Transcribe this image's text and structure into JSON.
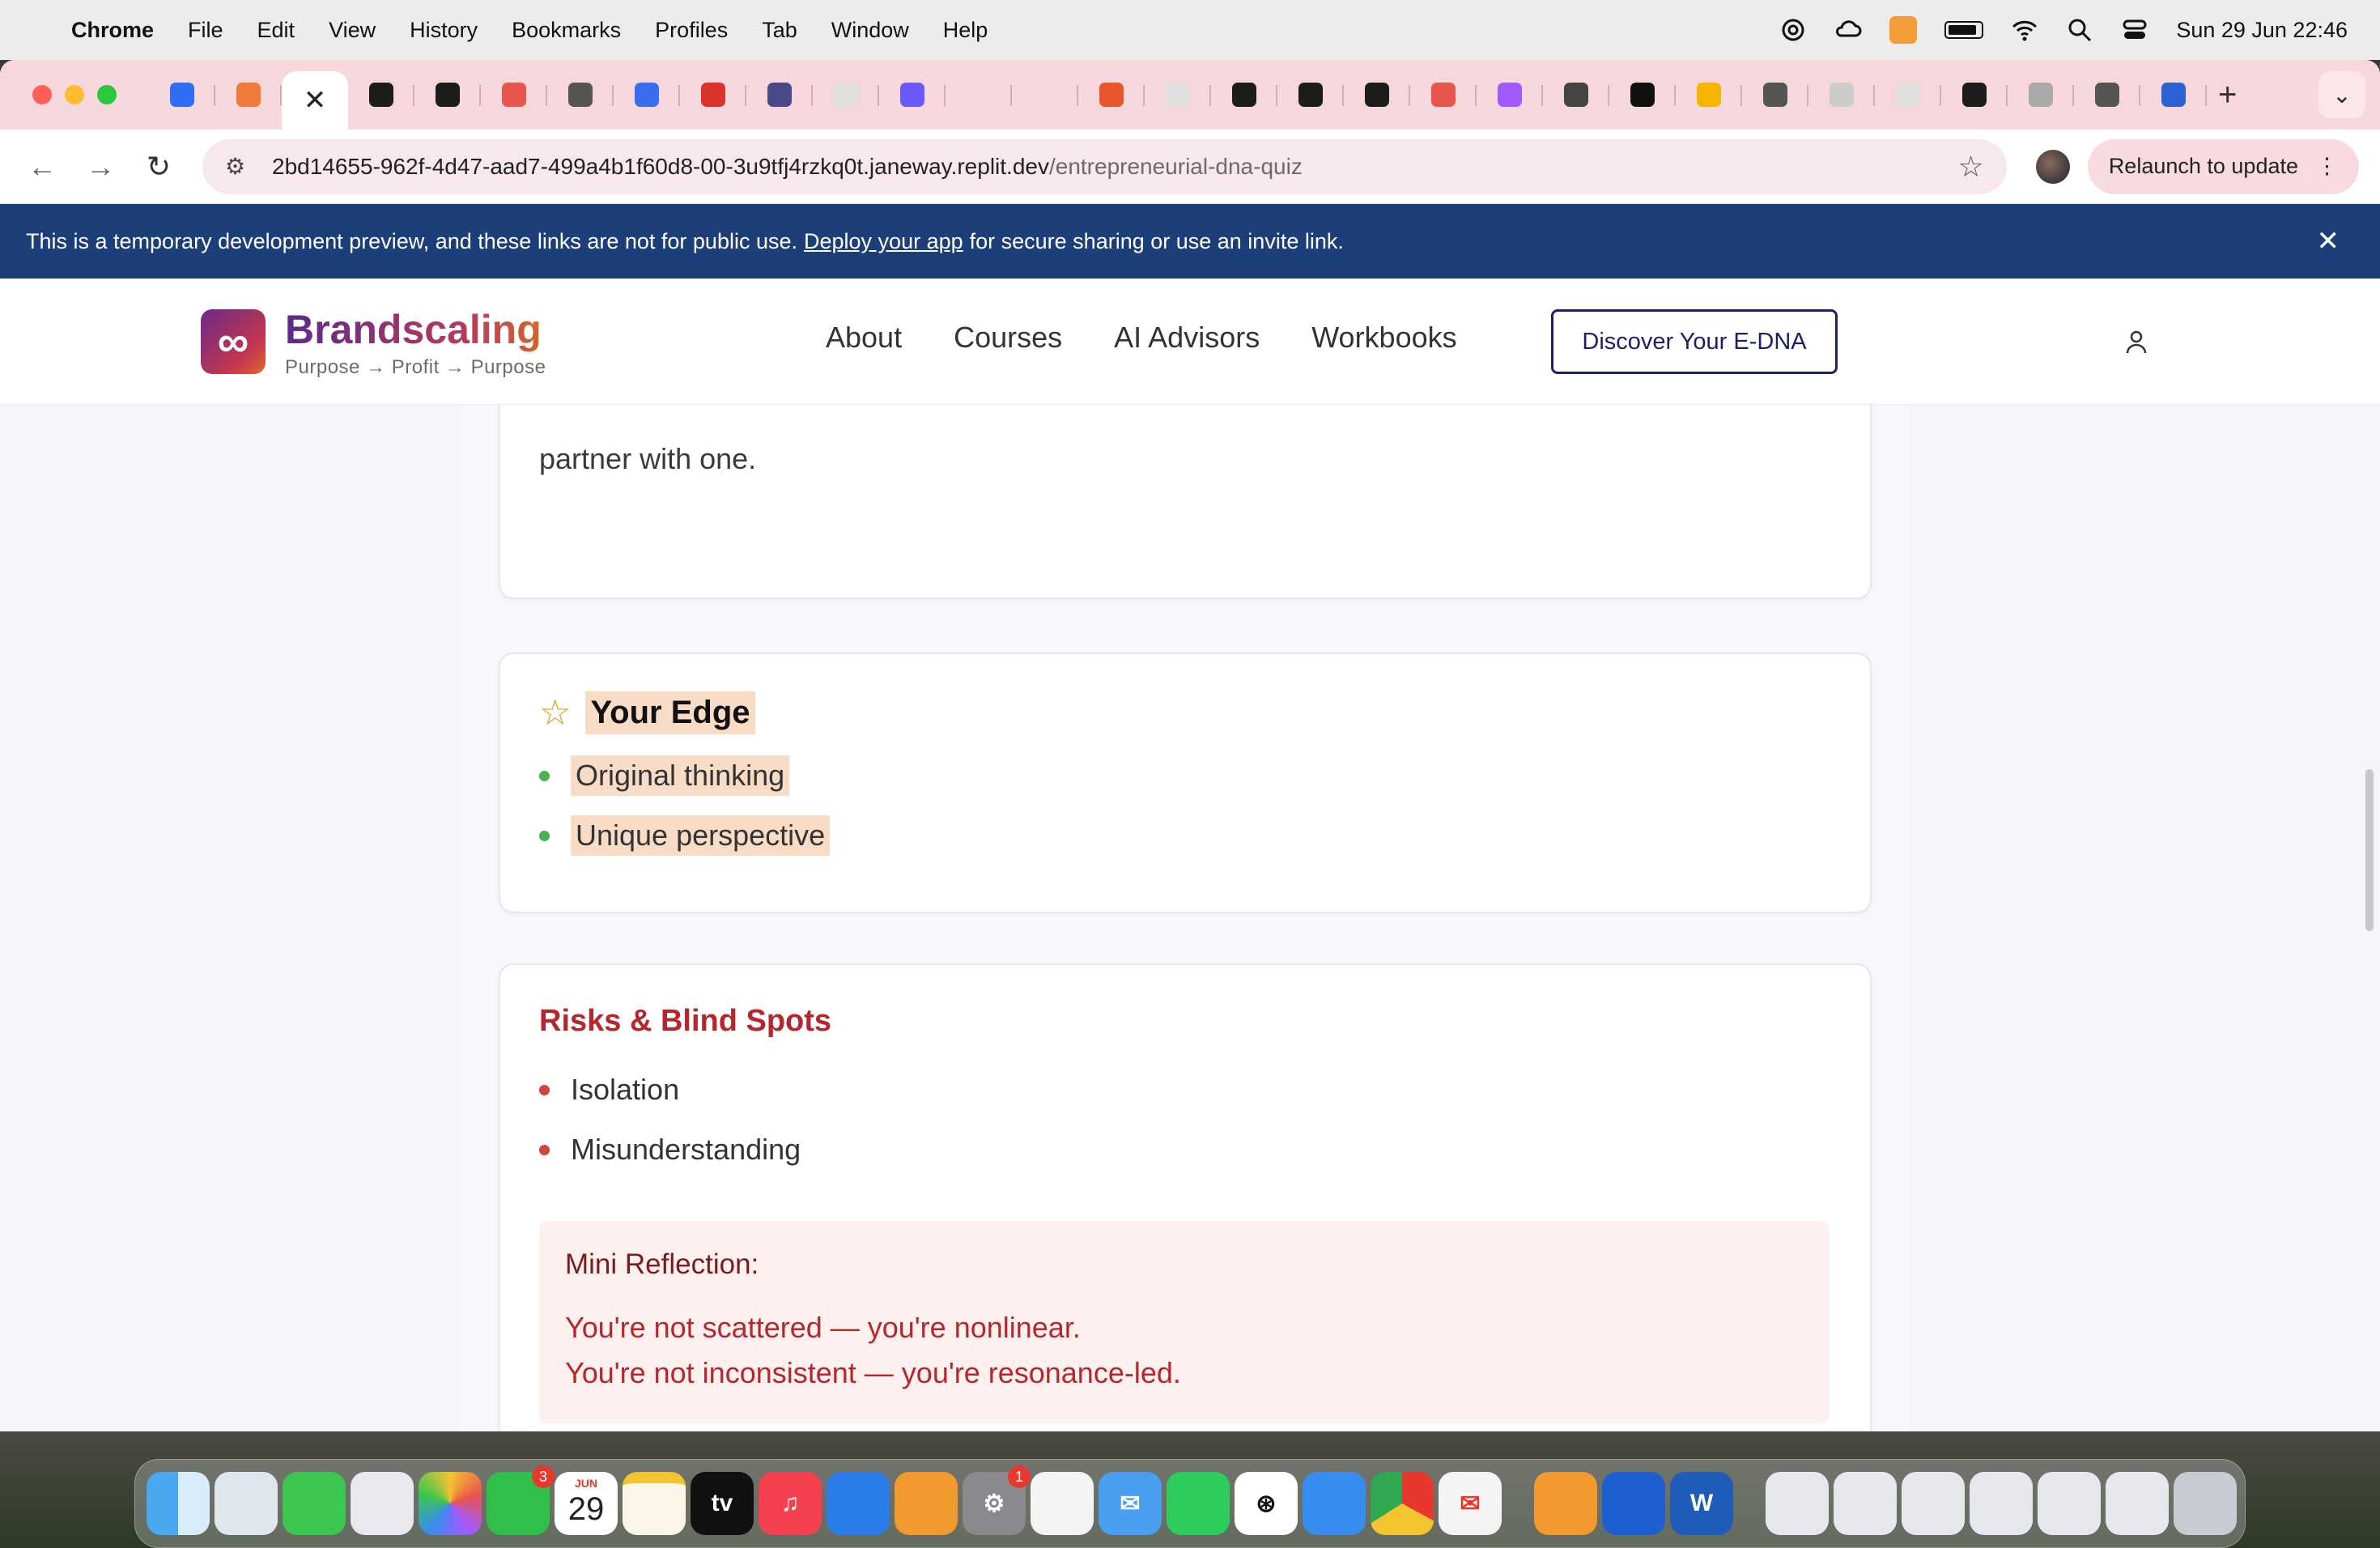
{
  "menubar": {
    "app": "Chrome",
    "items": [
      "File",
      "Edit",
      "View",
      "History",
      "Bookmarks",
      "Profiles",
      "Tab",
      "Window",
      "Help"
    ],
    "clock": "Sun 29 Jun  22:46"
  },
  "browser": {
    "url_host": "2bd14655-962f-4d47-aad7-499a4b1f60d8-00-3u9tfj4rzkq0t.janeway.replit.dev",
    "url_path": "/entrepreneurial-dna-quiz",
    "relaunch_label": "Relaunch to update",
    "tab_colors": [
      "#2f6df6",
      "#f07a3a",
      "#ffffff",
      "#1c1c1c",
      "#1c1c1c",
      "#e8554e",
      "#555555",
      "#3a6df0",
      "#d9342b",
      "#4a4a8a",
      "#e0e0e0",
      "#6a5af9",
      "#f6d7dc",
      "#f6d7dc",
      "#e8552e",
      "#e0e0e0",
      "#1c1c1c",
      "#1c1c1c",
      "#1c1c1c",
      "#e8554e",
      "#a259ff",
      "#444444",
      "#111111",
      "#f4b400",
      "#555555",
      "#cccccc",
      "#e0e0e0",
      "#1c1c1c",
      "#aaaaaa",
      "#555555",
      "#2a62d4"
    ]
  },
  "dev_banner": {
    "text_before": "This is a temporary development preview, and these links are not for public use.",
    "link_text": "Deploy your app",
    "text_after": "for secure sharing or use an invite link."
  },
  "site": {
    "brand": "Brandscaling",
    "tagline": "Purpose → Profit → Purpose",
    "nav": [
      "About",
      "Courses",
      "AI Advisors",
      "Workbooks"
    ],
    "cta": "Discover Your E-DNA"
  },
  "previous_card": {
    "tail_text": "partner with one."
  },
  "edge_card": {
    "title": "Your Edge",
    "items": [
      "Original thinking",
      "Unique perspective"
    ]
  },
  "risk_card": {
    "title": "Risks & Blind Spots",
    "items": [
      "Isolation",
      "Misunderstanding"
    ],
    "reflection_title": "Mini Reflection:",
    "reflection_lines": [
      "You're not scattered — you're nonlinear.",
      "You're not inconsistent — you're resonance-led."
    ]
  },
  "dock": {
    "facetime_badge": "3",
    "calendar_month": "JUN",
    "calendar_day": "29",
    "settings_badge": "1",
    "tv_label": "tv"
  }
}
